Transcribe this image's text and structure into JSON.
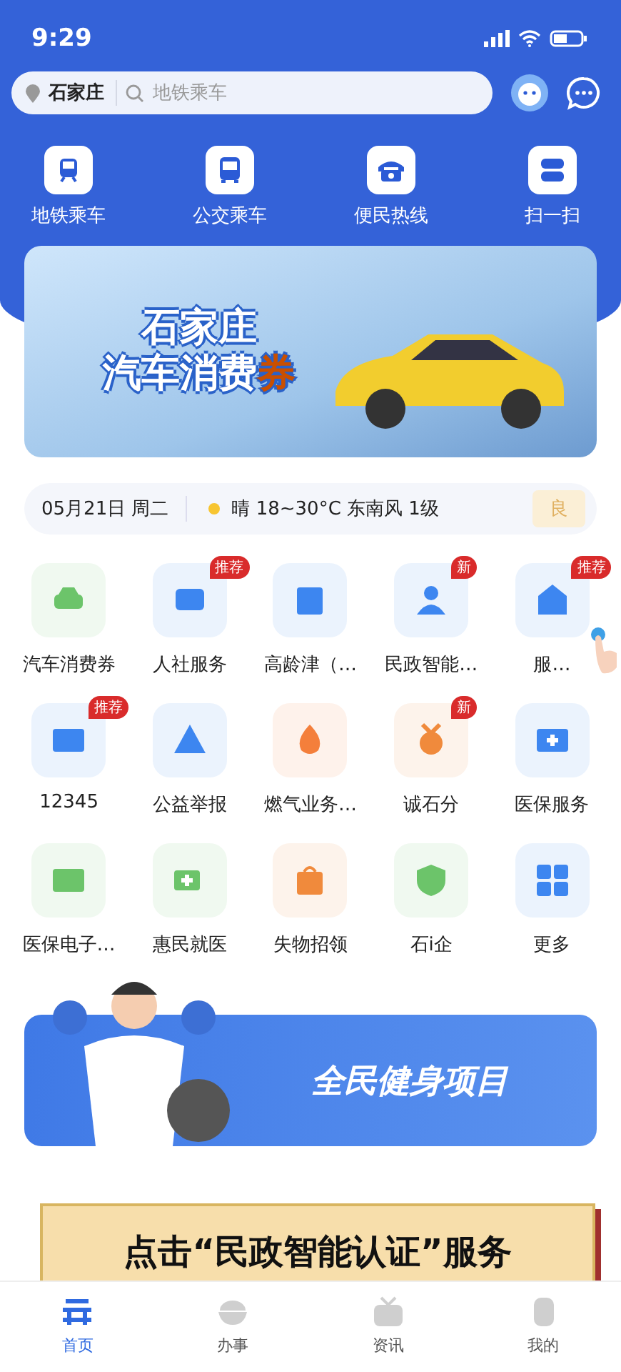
{
  "status_bar": {
    "time": "9:29"
  },
  "search": {
    "city": "石家庄",
    "placeholder": "地铁乘车"
  },
  "quick_actions": [
    {
      "label": "地铁乘车"
    },
    {
      "label": "公交乘车"
    },
    {
      "label": "便民热线"
    },
    {
      "label": "扫一扫"
    }
  ],
  "promo_banner": {
    "title_line_1": "石家庄",
    "title_line_2": "汽车消费",
    "title_highlight": "券"
  },
  "weather": {
    "date": "05月21日 周二",
    "forecast": "晴 18~30°C 东南风 1级",
    "air_quality": "良"
  },
  "services": [
    {
      "label": "汽车消费券",
      "color": "#6cc46a"
    },
    {
      "label": "人社服务",
      "color": "#3d86f0",
      "badge": "推荐"
    },
    {
      "label": "高龄津（…",
      "color": "#3d86f0"
    },
    {
      "label": "民政智能…",
      "color": "#3d86f0",
      "badge": "新"
    },
    {
      "label": "服…",
      "color": "#3d86f0",
      "badge": "推荐"
    },
    {
      "label": "12345",
      "color": "#3d86f0",
      "badge": "推荐"
    },
    {
      "label": "公益举报",
      "color": "#3d86f0"
    },
    {
      "label": "燃气业务…",
      "color": "#f47f3b"
    },
    {
      "label": "诚石分",
      "color": "#f08a3c",
      "badge": "新"
    },
    {
      "label": "医保服务",
      "color": "#3d86f0"
    },
    {
      "label": "医保电子…",
      "color": "#6cc46a"
    },
    {
      "label": "惠民就医",
      "color": "#6cc46a"
    },
    {
      "label": "失物招领",
      "color": "#f08a3c"
    },
    {
      "label": "石i企",
      "color": "#6cc46a"
    },
    {
      "label": "更多",
      "color": "#3d86f0"
    }
  ],
  "fitness_banner": {
    "title": "全民健身项目"
  },
  "caption": {
    "text": "点击“民政智能认证”服务"
  },
  "tabs": [
    {
      "label": "首页",
      "selected": true
    },
    {
      "label": "办事",
      "selected": false
    },
    {
      "label": "资讯",
      "selected": false
    },
    {
      "label": "我的",
      "selected": false
    }
  ]
}
